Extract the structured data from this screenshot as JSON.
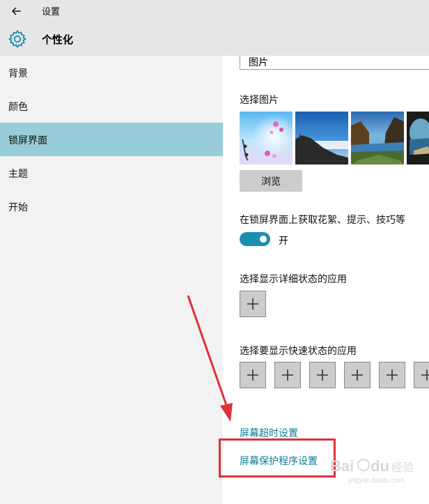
{
  "window": {
    "title": "设置",
    "page_title": "个性化"
  },
  "icons": {
    "back": "back-arrow-icon",
    "settings": "gear-icon",
    "dropdown": "chevron-down-icon",
    "add": "plus-icon"
  },
  "sidebar": {
    "items": [
      {
        "label": "背景",
        "active": false
      },
      {
        "label": "颜色",
        "active": false
      },
      {
        "label": "锁屏界面",
        "active": true
      },
      {
        "label": "主题",
        "active": false
      },
      {
        "label": "开始",
        "active": false
      }
    ]
  },
  "main": {
    "background_select": {
      "value": "图片"
    },
    "choose_picture_label": "选择图片",
    "pictures": [
      "thumbnail-1",
      "thumbnail-2",
      "thumbnail-3",
      "thumbnail-4"
    ],
    "browse_label": "浏览",
    "fun_facts_label": "在锁屏界面上获取花絮、提示、技巧等",
    "fun_facts_toggle": {
      "state": "开",
      "on": true
    },
    "detailed_status_label": "选择显示详细状态的应用",
    "quick_status_label": "选择要显示快速状态的应用",
    "screen_timeout_link": "屏幕超时设置",
    "screensaver_link": "屏幕保护程序设置"
  },
  "colors": {
    "accent": "#1a8fb0",
    "selected_nav": "#96cdd8",
    "link": "#0f7d98",
    "annotation": "#e0303a"
  },
  "watermark": {
    "text": "Baidu 经验",
    "subtext": "jingyan.baidu.com"
  }
}
